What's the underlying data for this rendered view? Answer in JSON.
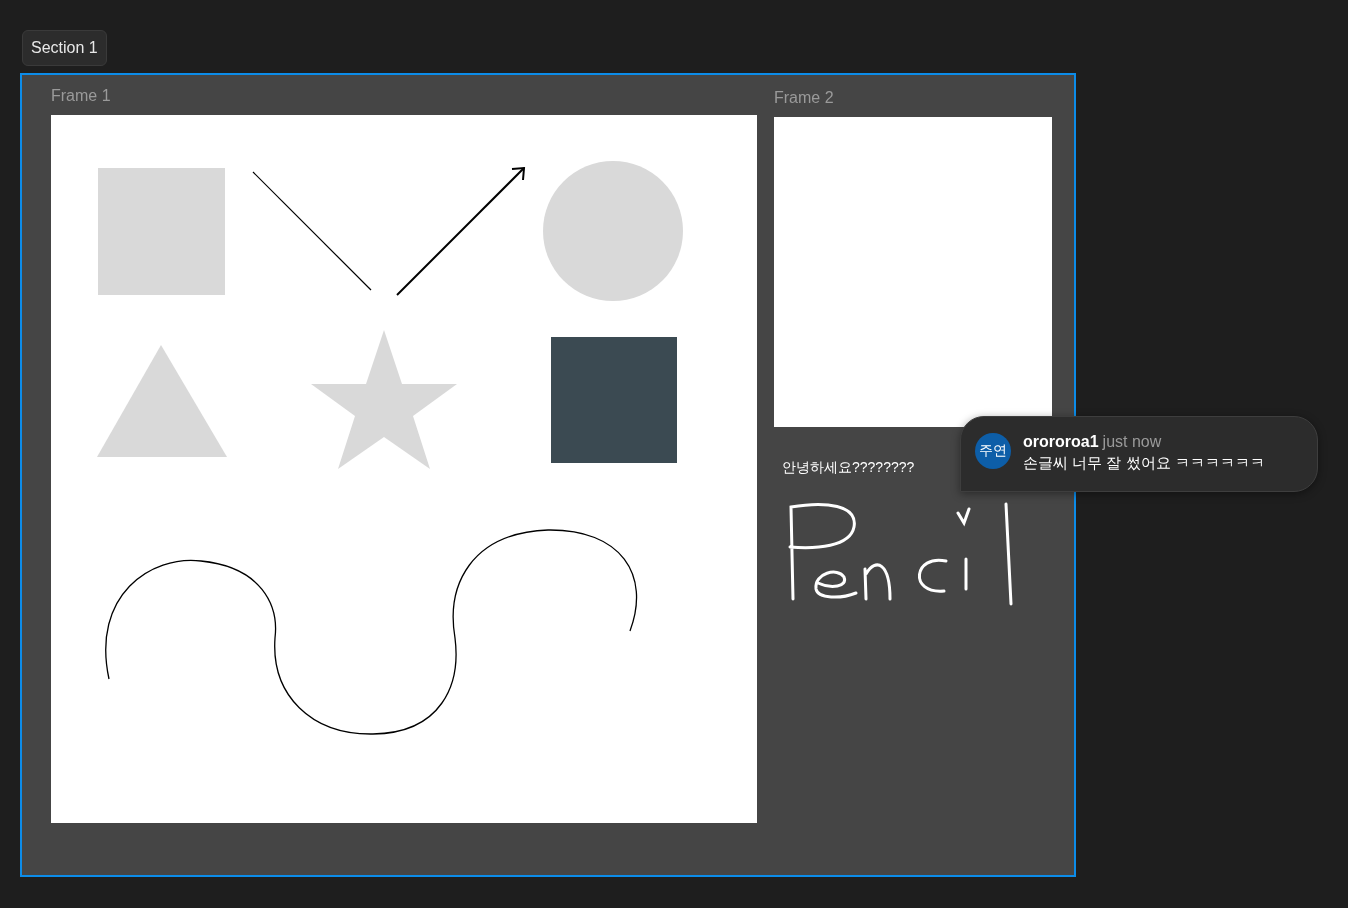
{
  "section": {
    "label": "Section 1"
  },
  "frames": [
    {
      "title": "Frame 1"
    },
    {
      "title": "Frame 2"
    }
  ],
  "frame_2_text": "안녕하세요????????",
  "comment": {
    "avatar": "주연",
    "author": "orororoa1",
    "time": "just now",
    "message": "손글씨 너무 잘 썼어요 ㅋㅋㅋㅋㅋㅋ"
  }
}
